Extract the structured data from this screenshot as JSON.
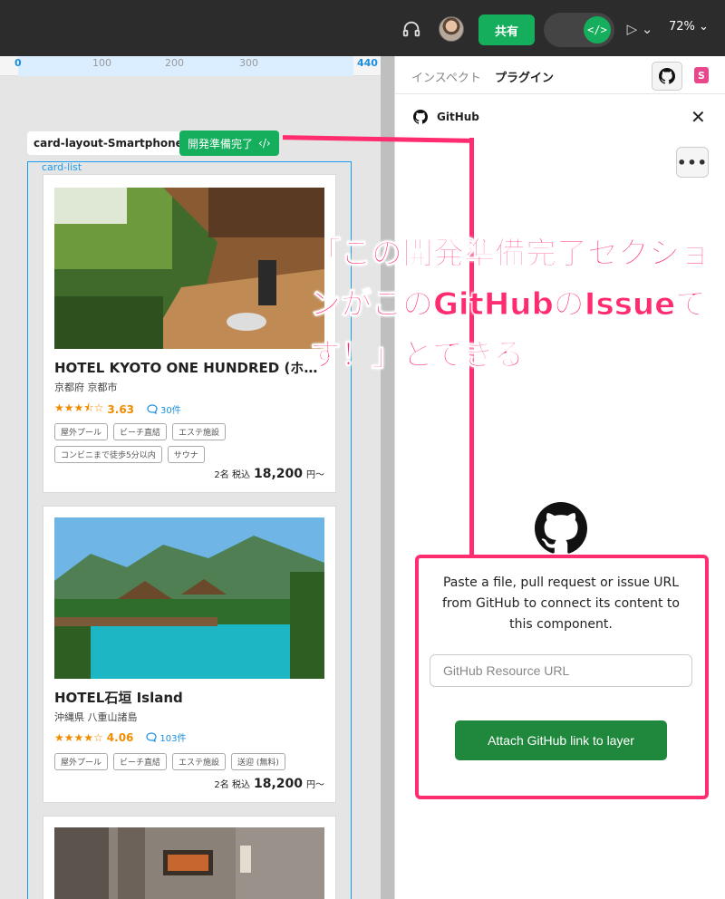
{
  "topbar": {
    "share_label": "共有",
    "dev_mode_icon": "</>",
    "play_icon": "▷ ⌄",
    "zoom": "72% ⌄"
  },
  "ruler": {
    "labels": [
      "0",
      "100",
      "200",
      "300",
      "440"
    ]
  },
  "canvas": {
    "frame_name": "card-layout-Smartphone",
    "ready_badge": "開発準備完了",
    "ready_badge_icon": "‹/›",
    "card_list_label": "card-list"
  },
  "cards": [
    {
      "title": "HOTEL KYOTO ONE HUNDRED (ホテル…",
      "location": "京都府 京都市",
      "stars": "★★★⯪☆",
      "score": "3.63",
      "comments": "30件",
      "tags": [
        "屋外プール",
        "ビーチ直結",
        "エステ施設",
        "コンビニまで徒歩5分以内",
        "サウナ"
      ],
      "price_meta": "2名 税込",
      "price": "18,200",
      "price_suffix": "円〜"
    },
    {
      "title": "HOTEL石垣 Island",
      "location": "沖縄県 八重山諸島",
      "stars": "★★★★☆",
      "score": "4.06",
      "comments": "103件",
      "tags": [
        "屋外プール",
        "ビーチ直結",
        "エステ施設",
        "送迎 (無料)"
      ],
      "price_meta": "2名 税込",
      "price": "18,200",
      "price_suffix": "円〜"
    }
  ],
  "panel": {
    "tab_inspect": "インスペクト",
    "tab_plugin": "プラグイン",
    "plugin_title": "GitHub",
    "more_label": "•••",
    "description": "Paste a file, pull request or issue URL from GitHub to connect its content to this component.",
    "url_placeholder": "GitHub Resource URL",
    "attach_label": "Attach GitHub link to layer"
  },
  "annotation": {
    "text": "「この開発準備完了セクションがこのGitHubのIssueです！」とできる",
    "color": "#ff2d6f"
  },
  "colors": {
    "accent_green": "#14ae5c",
    "github_green": "#1f883d",
    "selection_blue": "#1a9cf0",
    "rating_orange": "#f08c00"
  }
}
